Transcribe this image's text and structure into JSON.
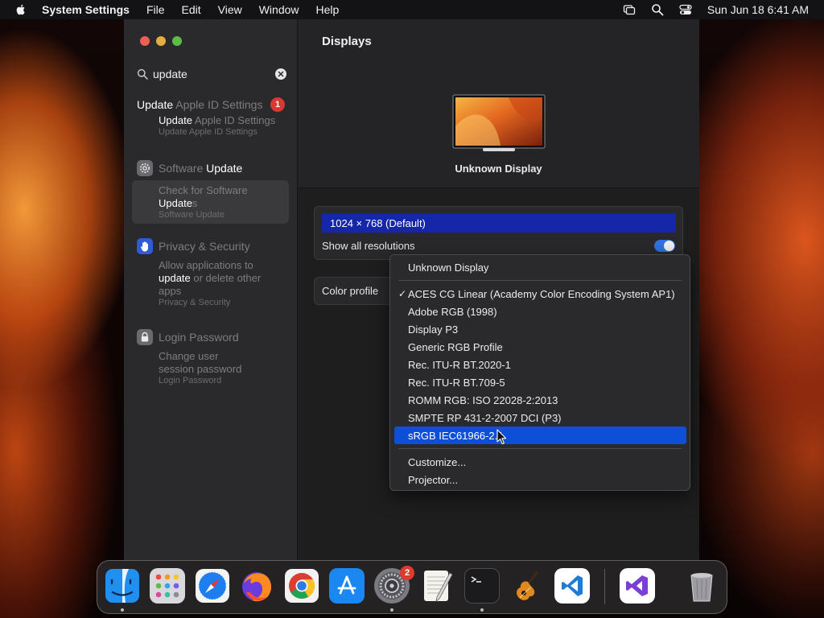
{
  "menubar": {
    "app_name": "System Settings",
    "menus": [
      "File",
      "Edit",
      "View",
      "Window",
      "Help"
    ],
    "clock": "Sun Jun 18  6:41 AM"
  },
  "sidebar": {
    "search": {
      "value": "update"
    },
    "groups": [
      {
        "head_hl": "Update",
        "head_dim": " Apple ID Settings",
        "badge": "1",
        "subs": [
          {
            "line1_hl": "Update",
            "line1_dim": " Apple ID Settings",
            "caption": "Update Apple ID Settings"
          }
        ]
      },
      {
        "head_dim": "Software",
        "head_hl": " Update",
        "subs": [
          {
            "line1_dim": "Check for Software",
            "line2_hl": "Update",
            "line2_dim": "s",
            "caption": "Software Update"
          }
        ]
      },
      {
        "head_dim": "Privacy & Security",
        "subs": [
          {
            "line1_dim": "Allow applications to",
            "line2_hl": "update",
            "line2_dim": " or delete other",
            "line3_dim": "apps",
            "caption": "Privacy & Security"
          }
        ]
      },
      {
        "head_dim": "Login Password",
        "subs": [
          {
            "line1_dim": "Change user",
            "line2_dim": "session password",
            "caption": "Login Password"
          }
        ]
      }
    ]
  },
  "main": {
    "title": "Displays",
    "display_name": "Unknown Display",
    "resolution": "1024 × 768 (Default)",
    "show_all_label": "Show all resolutions",
    "show_all_on": true,
    "color_profile_label": "Color profile"
  },
  "dropdown": {
    "header": "Unknown Display",
    "items": [
      "ACES CG Linear (Academy Color Encoding System AP1)",
      "Adobe RGB (1998)",
      "Display P3",
      "Generic RGB Profile",
      "Rec. ITU-R BT.2020-1",
      "Rec. ITU-R BT.709-5",
      "ROMM RGB: ISO 22028-2:2013",
      "SMPTE RP 431-2-2007 DCI (P3)",
      "sRGB IEC61966-2.1"
    ],
    "checked_index": 0,
    "highlighted_index": 8,
    "check_mark": "✓",
    "extra": [
      "Customize...",
      "Projector..."
    ]
  },
  "dock": {
    "apps": [
      "finder-icon",
      "launchpad-icon",
      "safari-icon",
      "firefox-icon",
      "chrome-icon",
      "app-store-icon",
      "system-settings-icon",
      "textedit-icon",
      "terminal-icon",
      "garageband-icon",
      "vscode-icon",
      "visual-studio-icon",
      "trash-icon"
    ],
    "settings_badge": "2"
  },
  "colors": {
    "accent": "#0d4fd6",
    "resolution_highlight": "#1526a8",
    "badge_red": "#d63a33",
    "toggle_blue": "#2f72e0"
  }
}
